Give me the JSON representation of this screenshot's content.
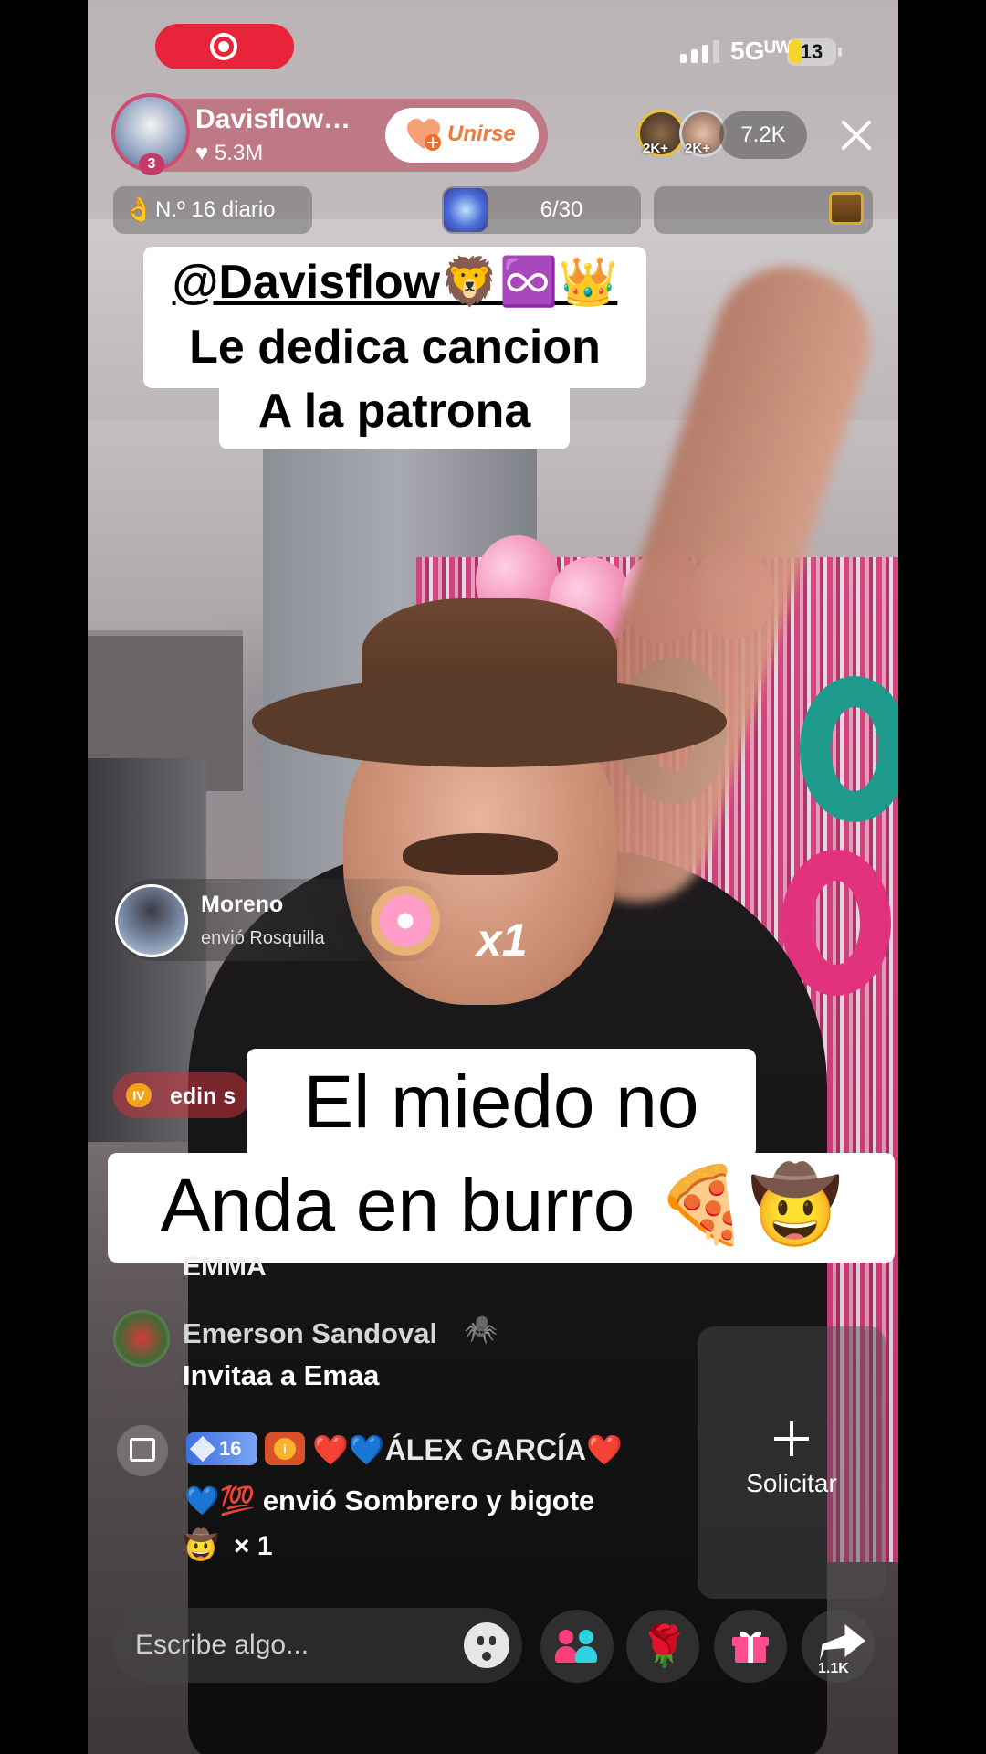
{
  "status_bar": {
    "network": "5Gᵁᵂ",
    "battery": "13"
  },
  "host": {
    "name": "Davisflow…",
    "rank_badge": "3",
    "likes": "5.3M",
    "follow_label": "Unirse"
  },
  "viewers": {
    "top1_tag": "2K+",
    "top2_tag": "2K+",
    "count": "7.2K"
  },
  "info_pills": {
    "daily_rank": "N.º 16 diario",
    "goal": "6/30"
  },
  "top_caption": {
    "mention": "@Davisflow🦁♾️👑",
    "line2": "Le dedica cancion",
    "line3": "A la patrona"
  },
  "gift_alert": {
    "user": "Moreno",
    "action": "envió Rosquilla",
    "count": "x1"
  },
  "join_banner": {
    "badge": "IV",
    "name": "edin s"
  },
  "center_caption": {
    "line1": "El miedo no",
    "line2": "Anda en burro 🍕🤠"
  },
  "comments": [
    {
      "name": "EMMA"
    },
    {
      "name": "Emerson Sandoval",
      "suffix": "🕷️",
      "text": "Invitaa a Emaa"
    }
  ],
  "gift_message": {
    "level": "16",
    "fan_badge": "i",
    "sender": "❤️💙ÁLEX GARCÍA❤️",
    "line2_prefix": "💙💯",
    "line2": " envió Sombrero y bigote",
    "item_icon": "🤠",
    "item_count": "× 1"
  },
  "request_panel": {
    "label": "Solicitar"
  },
  "bottom_bar": {
    "placeholder": "Escribe algo...",
    "rose": "🌹",
    "share_count": "1.1K"
  },
  "icons": {
    "record": "record-icon",
    "signal": "signal-icon",
    "battery": "battery-icon",
    "close": "close-icon",
    "fire": "fire-icon",
    "star": "star-icon",
    "chest": "treasure-chest-icon",
    "donut": "donut-icon",
    "gift": "gift-icon",
    "emoji": "emoji-icon",
    "people": "people-icon",
    "share": "share-icon"
  }
}
